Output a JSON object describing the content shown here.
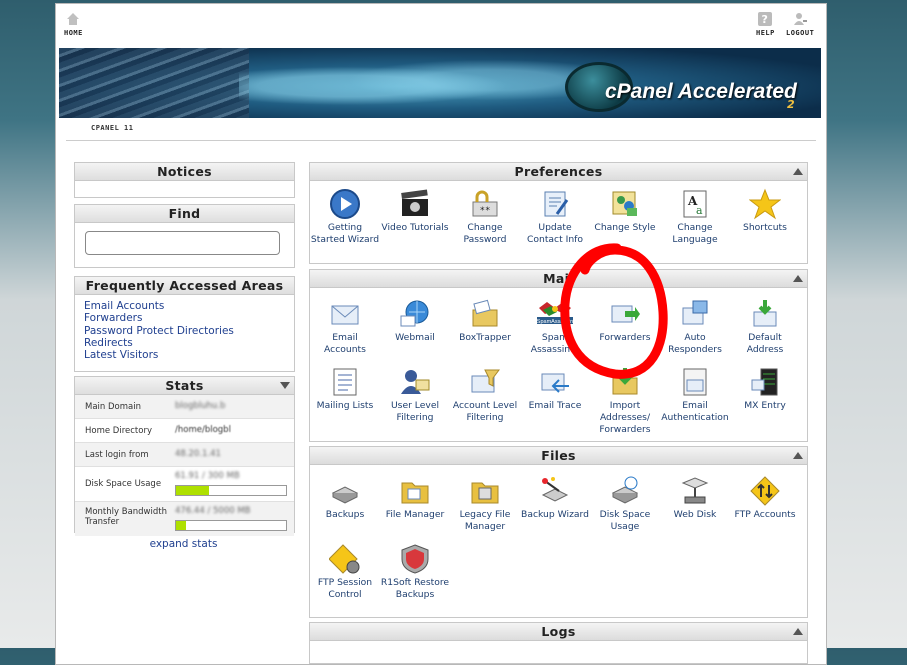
{
  "topnav": {
    "home": "HOME",
    "help": "HELP",
    "logout": "LOGOUT"
  },
  "banner": {
    "brand": "cPanel Accelerated",
    "brand_suffix": "2"
  },
  "version_label": "CPANEL 11",
  "notices": {
    "title": "Notices"
  },
  "find": {
    "title": "Find",
    "placeholder": ""
  },
  "faa": {
    "title": "Frequently Accessed Areas",
    "links": [
      "Email Accounts",
      "Forwarders",
      "Password Protect Directories",
      "Redirects",
      "Latest Visitors"
    ]
  },
  "stats": {
    "title": "Stats",
    "main_domain": {
      "label": "Main Domain",
      "value": "blogbluhu.b"
    },
    "home_directory": {
      "label": "Home Directory",
      "value": "/home/blogbl"
    },
    "last_login": {
      "label": "Last login from",
      "value": "48.20.1.41"
    },
    "disk_space": {
      "label": "Disk Space Usage",
      "value": "61.91 / 300 MB",
      "fraction": 0.3
    },
    "bandwidth": {
      "label": "Monthly Bandwidth Transfer",
      "value": "476.44 / 5000 MB",
      "fraction": 0.09
    },
    "expand": "expand stats"
  },
  "preferences": {
    "title": "Preferences",
    "items": [
      "Getting Started Wizard",
      "Video Tutorials",
      "Change Password",
      "Update Contact Info",
      "Change Style",
      "Change Language",
      "Shortcuts"
    ]
  },
  "mail": {
    "title": "Mail",
    "items": [
      "Email Accounts",
      "Webmail",
      "BoxTrapper",
      "Spam Assassin™",
      "Forwarders",
      "Auto Responders",
      "Default Address",
      "Mailing Lists",
      "User Level Filtering",
      "Account Level Filtering",
      "Email Trace",
      "Import Addresses/ Forwarders",
      "Email Authentication",
      "MX Entry"
    ],
    "spam_logo_text": "SpamAssassin"
  },
  "files": {
    "title": "Files",
    "items": [
      "Backups",
      "File Manager",
      "Legacy File Manager",
      "Backup Wizard",
      "Disk Space Usage",
      "Web Disk",
      "FTP Accounts",
      "FTP Session Control",
      "R1Soft Restore Backups"
    ]
  },
  "logs": {
    "title": "Logs"
  },
  "colors": {
    "annotation": "#ff0000",
    "link": "#1f3f8f",
    "bar_fill": "#aee000"
  }
}
